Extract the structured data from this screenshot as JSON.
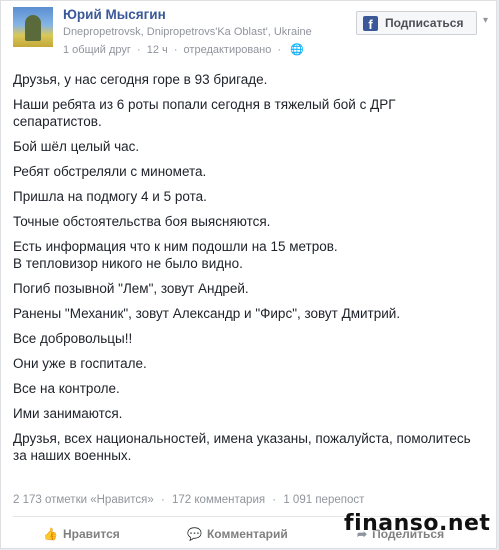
{
  "post": {
    "author": "Юрий Мысягин",
    "location": "Dnepropetrovsk, Dnipropetrovs'Ka Oblast', Ukraine",
    "meta": {
      "mutual_friends": "1 общий друг",
      "time": "12 ч",
      "edited": "отредактировано",
      "globe_icon": "🌐"
    },
    "subscribe_button": {
      "icon": "f",
      "label": "Подписаться"
    },
    "menu_chevron": "▾",
    "text": [
      "Друзья, у нас сегодня горе в 93 бригаде.",
      "Наши ребята из 6 роты попали сегодня в тяжелый бой с ДРГ сепаратистов.",
      "Бой шёл целый час.",
      "Ребят обстреляли с миномета.",
      "Пришла на подмогу 4 и 5 рота.",
      "Точные обстоятельства боя выясняются.",
      "Есть информация что к ним подошли на 15 метров.\nВ тепловизор никого не было видно.",
      "Погиб позывной \"Лем\", зовут Андрей.",
      "Ранены \"Механик\", зовут Александр и \"Фирс\", зовут Дмитрий.",
      "Все добровольцы!!",
      "Они уже в госпитале.",
      "Все на контроле.",
      "Ими занимаются.",
      "Друзья, всех национальностей, имена указаны, пожалуйста, помолитесь за наших военных."
    ],
    "stats": {
      "likes": "2 173 отметки «Нравится»",
      "comments": "172 комментария",
      "shares": "1 091 перепост",
      "separator": "·"
    },
    "actions": {
      "like": "Нравится",
      "comment": "Комментарий",
      "share": "Поделиться"
    },
    "watermark": "finanso.net"
  },
  "colors": {
    "link_blue": "#3b5998",
    "meta_gray": "#90949c",
    "text": "#1d2129"
  }
}
